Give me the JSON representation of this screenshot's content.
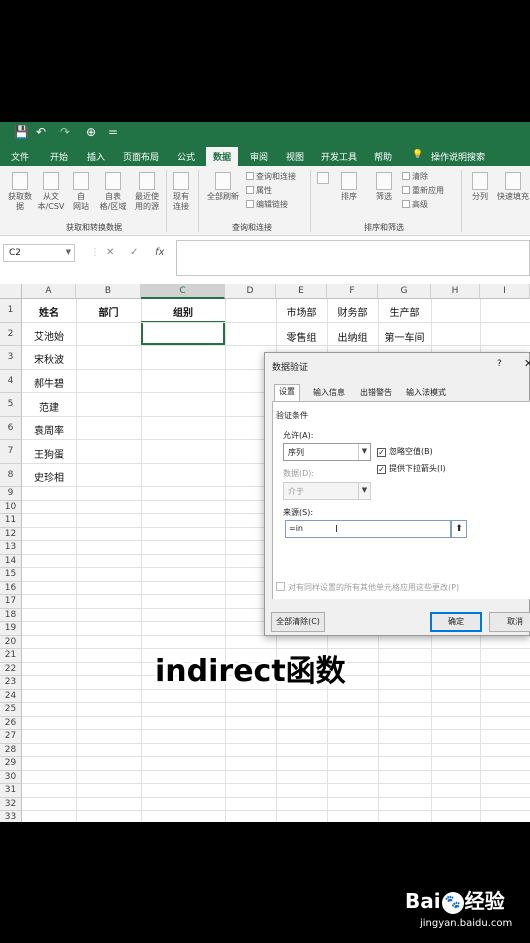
{
  "qat": {
    "save": "💾",
    "undo": "↶",
    "redo": "↷",
    "more": "⊕",
    "dropdown": "="
  },
  "ribbon_tabs": [
    "文件",
    "开始",
    "插入",
    "页面布局",
    "公式",
    "数据",
    "审阅",
    "视图",
    "开发工具",
    "帮助",
    "操作说明搜索"
  ],
  "active_tab": "数据",
  "ribbon": {
    "get_data": "获取数\n据",
    "from_text": "从文\n本/CSV",
    "from_web": "自\n网站",
    "from_table": "自表\n格/区域",
    "recent": "最近使\n用的源",
    "existing": "现有\n连接",
    "group1": "获取和转换数据",
    "refresh_all": "全部刷新",
    "queries": "查询和连接",
    "properties": "属性",
    "edit_links": "编辑链接",
    "group2": "查询和连接",
    "sort": "排序",
    "filter": "筛选",
    "clear": "清除",
    "reapply": "重新应用",
    "advanced": "高级",
    "group3": "排序和筛选",
    "split": "分列",
    "flash_fill": "快速填充"
  },
  "formula_bar": {
    "name_box": "C2",
    "cancel": "✕",
    "enter": "✓",
    "fx": "fx",
    "value": ""
  },
  "columns": [
    "A",
    "B",
    "C",
    "D",
    "E",
    "F",
    "G",
    "H",
    "I"
  ],
  "rows": [
    "1",
    "2",
    "3",
    "4",
    "5",
    "6",
    "7",
    "8",
    "9",
    "10",
    "11",
    "12",
    "13",
    "14",
    "15",
    "16",
    "17",
    "18",
    "19",
    "20",
    "21",
    "22",
    "23",
    "24",
    "25",
    "26",
    "27",
    "28",
    "29",
    "30",
    "31",
    "32",
    "33"
  ],
  "cells": {
    "A1": "姓名",
    "B1": "部门",
    "C1": "组别",
    "A2": "艾池始",
    "A3": "宋秋波",
    "A4": "郝牛碧",
    "A5": "范建",
    "A6": "袁周率",
    "A7": "王狗蛋",
    "A8": "史珍相",
    "E1": "市场部",
    "F1": "财务部",
    "G1": "生产部",
    "E2": "零售组",
    "F2": "出纳组",
    "G2": "第一车间"
  },
  "dialog": {
    "title": "数据验证",
    "help": "?",
    "close": "✕",
    "tabs": [
      "设置",
      "输入信息",
      "出错警告",
      "输入法模式"
    ],
    "criteria_label": "验证条件",
    "allow_label": "允许(A):",
    "allow_value": "序列",
    "ignore_blank": "忽略空值(B)",
    "dropdown_arrow": "提供下拉箭头(I)",
    "data_label": "数据(D):",
    "data_value": "介于",
    "source_label": "来源(S):",
    "source_value": "=in",
    "apply_all": "对有同样设置的所有其他单元格应用这些更改(P)",
    "clear_all": "全部清除(C)",
    "ok": "确定",
    "cancel": "取消"
  },
  "subtitle": "indirect函数",
  "watermark": {
    "brand_a": "Bai",
    "brand_b": "经验",
    "url": "jingyan.baidu.com"
  }
}
